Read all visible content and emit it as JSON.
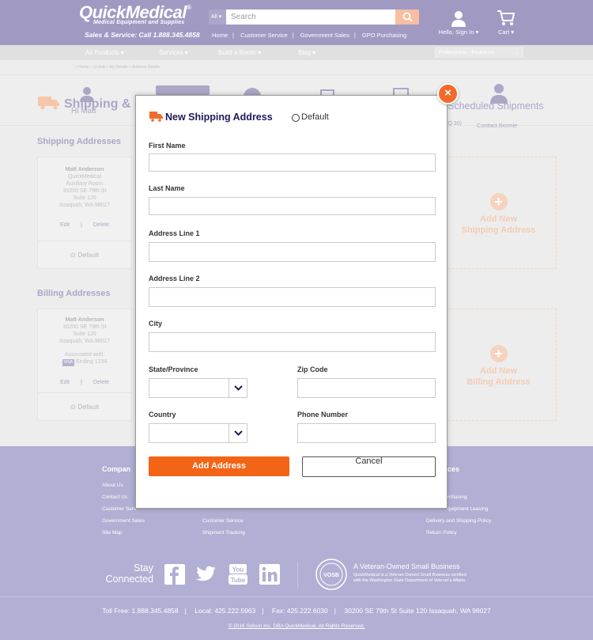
{
  "header": {
    "logo": "QuickMedical",
    "logo_mark": "®",
    "logo_sub": "Medical Equipment and Supplies",
    "sales_line": "Sales & Service: Call 1.888.345.4858",
    "search": {
      "category": "All",
      "placeholder": "Search"
    },
    "links": [
      "Home",
      "Customer Service",
      "Government Sales",
      "GPO Purchasing"
    ],
    "account_label": "Hello, Sign In",
    "cart_label": "Cart"
  },
  "nav": {
    "items": [
      "All Products",
      "Services",
      "Build a Room",
      "Blog"
    ],
    "select_value": "Professional - Pediatrics"
  },
  "page": {
    "breadcrumb": "» Home » Q-club » My Details » Address Details",
    "title": "Shipping &",
    "right_title": "Scheduled Shipments",
    "hi_name": "Hi Matt",
    "contact": "Contact Bonnie",
    "q_count": "(Q:30)",
    "shipping_title": "Shipping Addresses",
    "billing_title": "Billing Addresses",
    "shipping_card": {
      "name": "Matt Anderson",
      "lines": [
        "QuickMedical",
        "Auxiliary Room",
        "30200 SE 79th St",
        "Suite 120",
        "Issaquah, WA 98027"
      ],
      "edit": "Edit",
      "delete": "Delete",
      "default": "Default"
    },
    "billing_card": {
      "name": "Matt Anderson",
      "lines": [
        "30200 SE 79th St",
        "Suite 120",
        "Issaquah, WA 98027"
      ],
      "associated": "Associated with:",
      "card_brand": "VISA",
      "card_ending": "Ending 1234",
      "edit": "Edit",
      "delete": "Delete",
      "default": "Default"
    },
    "add_shipping": [
      "Add New",
      "Shipping Address"
    ],
    "add_billing": [
      "Add New",
      "Billing Address"
    ]
  },
  "modal": {
    "title": "New Shipping Address",
    "default_label": "Default",
    "fields": {
      "first_name": "First Name",
      "last_name": "Last Name",
      "address1": "Address Line 1",
      "address2": "Address Line 2",
      "city": "City",
      "state": "State/Province",
      "zip": "Zip Code",
      "country": "Country",
      "phone": "Phone Number"
    },
    "add_button": "Add Address",
    "cancel_button": "Cancel",
    "close_symbol": "×"
  },
  "footer": {
    "col1_title": "Compan",
    "col1_links": [
      "About Us",
      "Contact Us",
      "Customer Serv",
      "Government Sales",
      "Site Map"
    ],
    "col2_links": [
      "Customer Service",
      "Shipment Tracking"
    ],
    "col4_title": "ces",
    "col4_links": [
      "rchasing",
      "quipment Leasing",
      "Delivery and Shipping Policy",
      "Return Policy"
    ],
    "stay_connected": [
      "Stay",
      "Connected"
    ],
    "vosb_title": "A Veteran-Owned Small Business",
    "vosb_desc": [
      "QuickMedical is a Veteran-Owned Small Business certified",
      "with the Washington State Department of Veteran's Affairs."
    ],
    "vosb_seal": "VOSB",
    "contact": [
      "Toll Free: 1.888.345.4858",
      "Local: 425.222.5963",
      "Fax: 425.222.6030",
      "30200 SE 79th St Suite 120 Issaquah, WA 98027"
    ],
    "copyright": "© 2016 Solcon Inc. DBA QuickMedical. All Rights Reserved."
  },
  "colors": {
    "brand": "#7c73ac",
    "accent": "#f46417",
    "footer": "#9490c3"
  }
}
